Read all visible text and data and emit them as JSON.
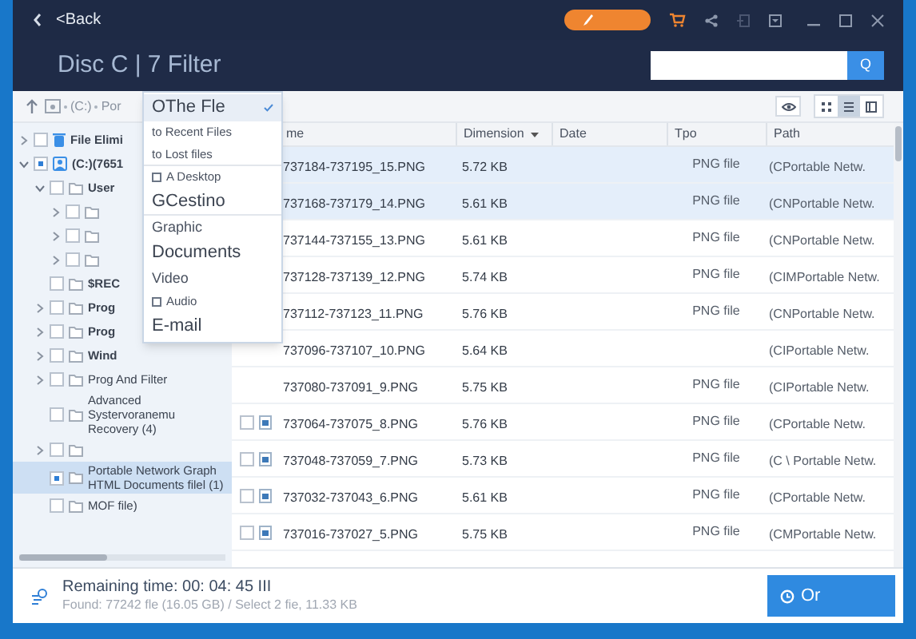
{
  "title_bar": {
    "back": "<Back"
  },
  "header": {
    "title": "Disc C | 7 Filter",
    "search_button": "Q"
  },
  "toolbar": {
    "breadcrumb": [
      "(C:)",
      "Por"
    ],
    "views": [
      {
        "kind": "grid",
        "selected": false
      },
      {
        "kind": "list",
        "selected": true
      },
      {
        "kind": "panel",
        "selected": false
      }
    ]
  },
  "tree": [
    {
      "label": "File Elimi",
      "kind": "trash",
      "bold": true,
      "expanded": false,
      "partial": false,
      "selected": false
    },
    {
      "label": "(C:)(7651",
      "kind": "drive",
      "bold": true,
      "expanded": true,
      "partial": true,
      "selected": false,
      "children": [
        {
          "label": "User",
          "kind": "folder",
          "bold": true,
          "expanded": true,
          "partial": false,
          "selected": false,
          "children": [
            {
              "kind": "folder",
              "expanded": false,
              "partial": false,
              "selected": false
            },
            {
              "kind": "folder",
              "expanded": false,
              "partial": false,
              "selected": false
            },
            {
              "kind": "folder",
              "expanded": false,
              "partial": false,
              "selected": false
            }
          ]
        },
        {
          "label": "$REC",
          "kind": "folder",
          "bold": true,
          "partial": false,
          "selected": false
        },
        {
          "label": "Prog",
          "kind": "folder",
          "bold": true,
          "expanded": false,
          "partial": false,
          "selected": false
        },
        {
          "label": "Prog",
          "kind": "folder",
          "bold": true,
          "expanded": false,
          "partial": false,
          "selected": false
        },
        {
          "label": "Wind",
          "kind": "folder",
          "bold": true,
          "expanded": false,
          "partial": false,
          "selected": false
        },
        {
          "label": "Prog And Filter",
          "kind": "folder",
          "bold": false,
          "expanded": false,
          "partial": false,
          "selected": false
        },
        {
          "label": "Advanced Systervoranemu Recovery (4)",
          "kind": "folder",
          "bold": false,
          "partial": false,
          "selected": false
        },
        {
          "kind": "folder",
          "expanded": false,
          "partial": false,
          "selected": false
        },
        {
          "label": "Portable Network Graph HTML Documents filel (1)",
          "kind": "folder",
          "bold": false,
          "partial": true,
          "selected": true
        },
        {
          "label": "MOF file)",
          "kind": "folder",
          "bold": false,
          "partial": false,
          "selected": false
        }
      ]
    }
  ],
  "menu": [
    {
      "label": "OThe Fle",
      "kind": "large",
      "selected": true
    },
    {
      "label": "to Recent Files",
      "kind": "small",
      "selected": false
    },
    {
      "label": "to Lost files",
      "kind": "small",
      "selected": false,
      "divider_after": true
    },
    {
      "label": "A Desktop",
      "kind": "small",
      "selected": false,
      "icon": true
    },
    {
      "label": "GCestino",
      "kind": "large",
      "selected": false,
      "divider_after": true
    },
    {
      "label": "Graphic",
      "kind": "medium",
      "selected": false
    },
    {
      "label": "Documents",
      "kind": "large",
      "selected": false
    },
    {
      "label": "Video",
      "kind": "medium",
      "selected": false
    },
    {
      "label": "Audio",
      "kind": "small",
      "selected": false,
      "icon": true
    },
    {
      "label": "E-mail",
      "kind": "large",
      "selected": false
    }
  ],
  "table": {
    "columns": [
      {
        "label": "me"
      },
      {
        "label": "Dimension",
        "sorted": true
      },
      {
        "label": "Date"
      },
      {
        "label": "Tpo"
      },
      {
        "label": "Path"
      }
    ],
    "rows": [
      {
        "name": "737184-737195_15.PNG",
        "size": "5.72 KB",
        "type": "PNG file",
        "path": "(CPortable Netw.",
        "selected": true
      },
      {
        "name": "737168-737179_14.PNG",
        "size": "5.61 KB",
        "type": "PNG file",
        "path": "(CNPortable Netw.",
        "selected": true
      },
      {
        "name": "737144-737155_13.PNG",
        "size": "5.61 KB",
        "type": "PNG file",
        "path": "(CNPortable Netw.",
        "selected": false
      },
      {
        "name": "737128-737139_12.PNG",
        "size": "5.74 KB",
        "type": "PNG file",
        "path": "(CIMPortable Netw.",
        "selected": false
      },
      {
        "name": "737112-737123_11.PNG",
        "size": "5.76 KB",
        "type": "PNG file",
        "path": "(CNPortable Netw.",
        "selected": false
      },
      {
        "name": "737096-737107_10.PNG",
        "size": "5.64 KB",
        "path": "(CIPortable Netw.",
        "selected": false
      },
      {
        "name": "737080-737091_9.PNG",
        "size": "5.75 KB",
        "type": "PNG file",
        "path": "(CIPortable Netw.",
        "selected": false
      },
      {
        "name": "737064-737075_8.PNG",
        "size": "5.76 KB",
        "type": "PNG file",
        "path": "(CPortable Netw.",
        "selected": false,
        "checked": false
      },
      {
        "name": "737048-737059_7.PNG",
        "size": "5.73 KB",
        "type": "PNG file",
        "path": "(C \\ Portable Netw.",
        "selected": false,
        "checked": false
      },
      {
        "name": "737032-737043_6.PNG",
        "size": "5.61 KB",
        "type": "PNG file",
        "path": "(CPortable Netw.",
        "selected": false,
        "checked": false
      },
      {
        "name": "737016-737027_5.PNG",
        "size": "5.75 KB",
        "type": "PNG file",
        "path": "(CMPortable Netw.",
        "selected": false,
        "checked": false
      }
    ]
  },
  "status": {
    "remaining": "Remaining time: 00: 04: 45 III",
    "found": "Found: 77242 fle (16.05 GB) / Select 2 fie, 11.33 KB",
    "button": "Or"
  }
}
